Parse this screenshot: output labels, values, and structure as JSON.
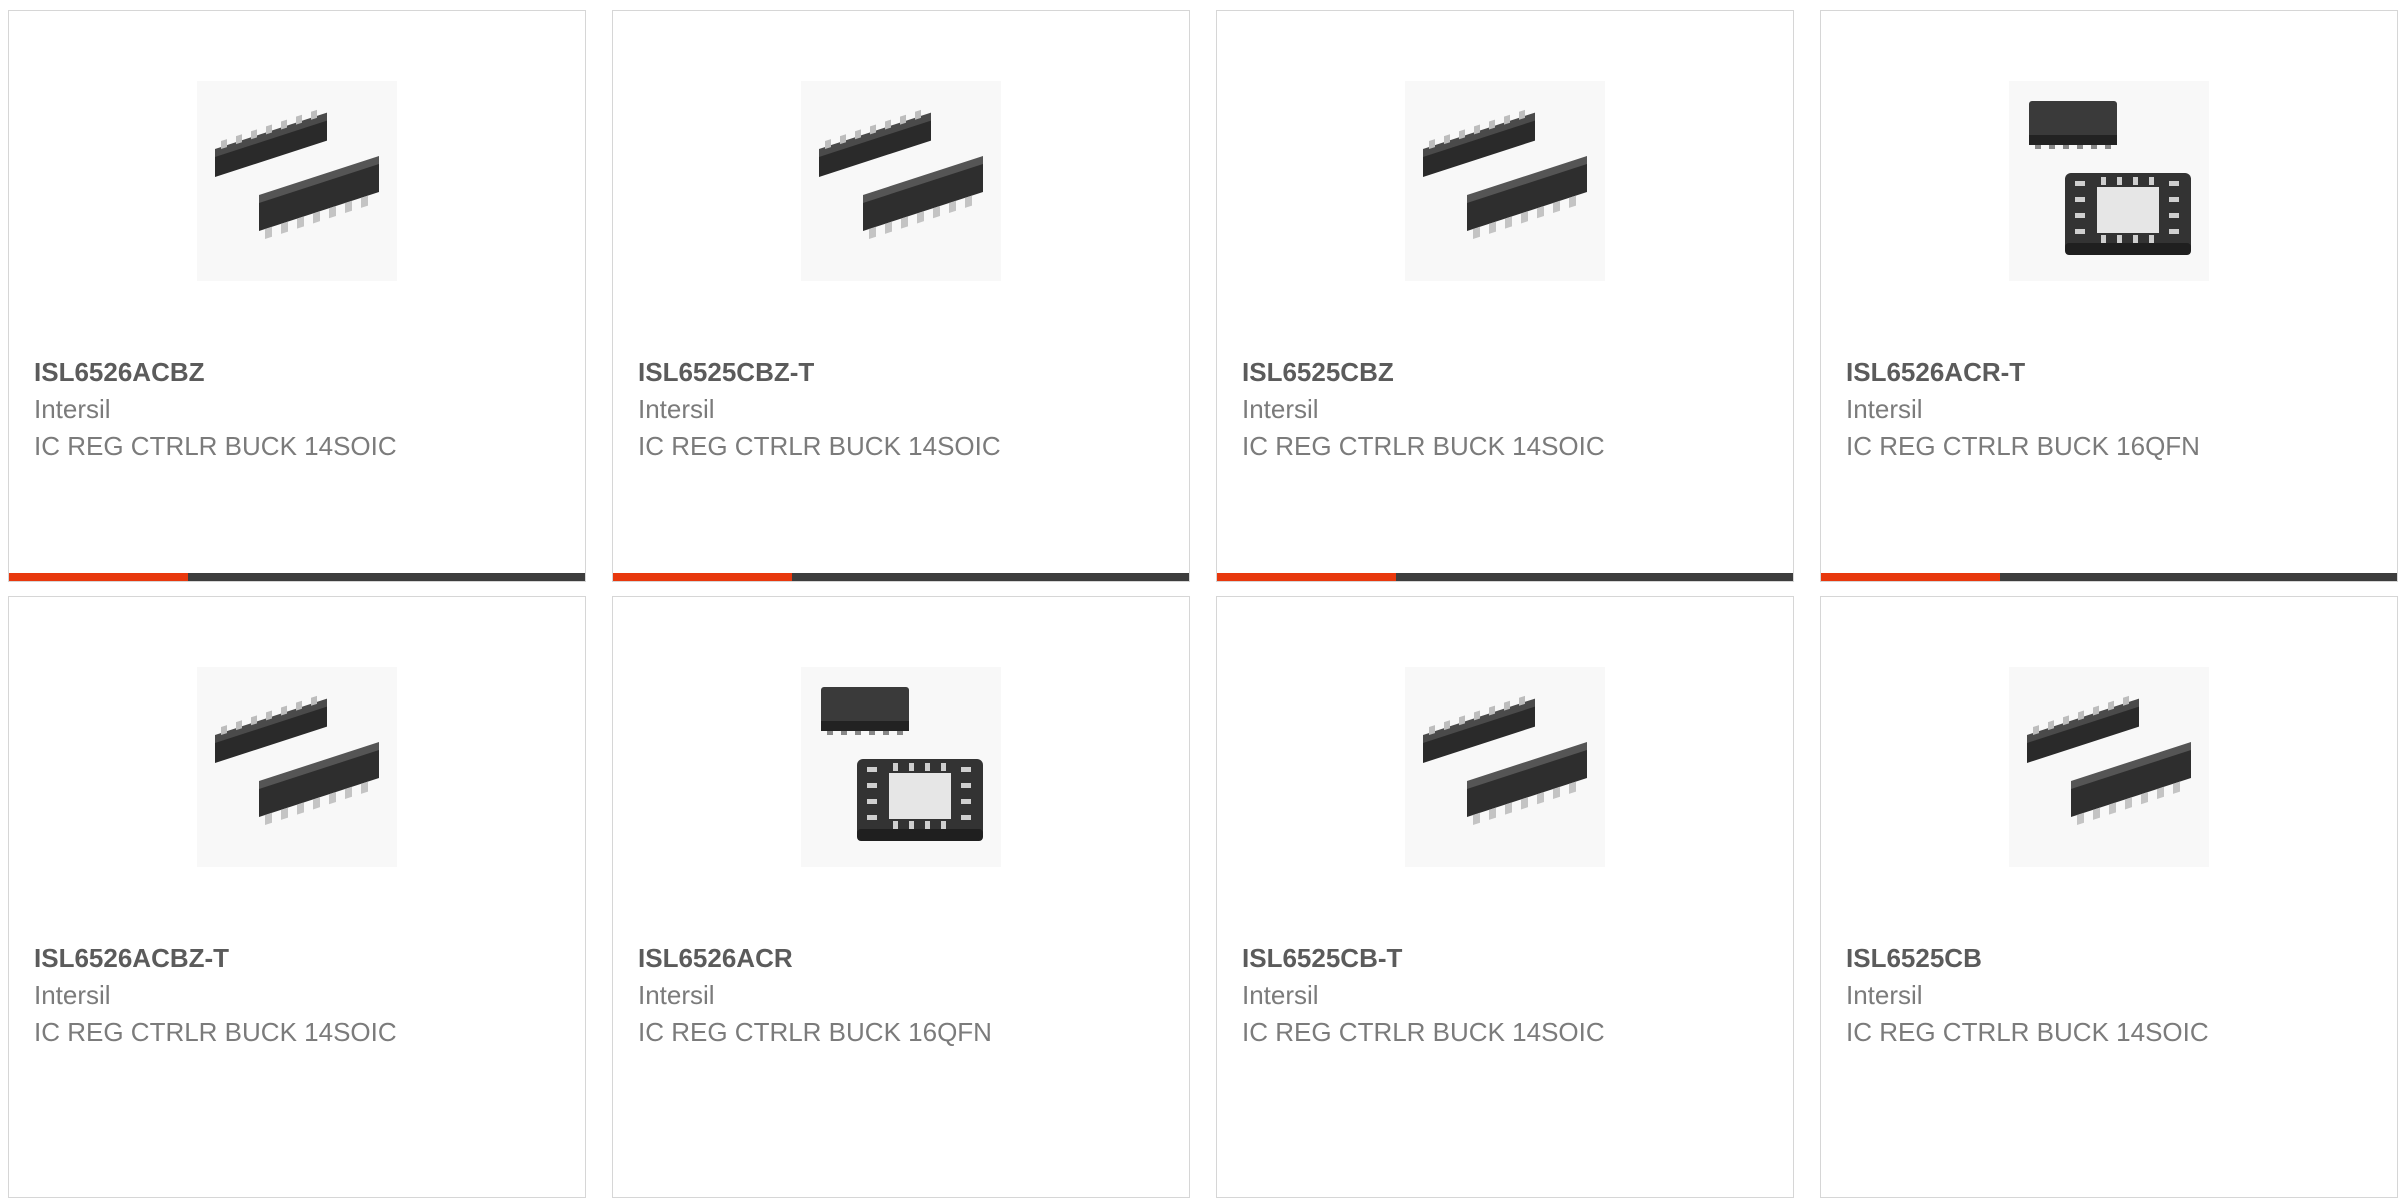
{
  "colors": {
    "accent": "#e8380d",
    "bar": "#3d3d3d",
    "part_text": "#5b5b5b",
    "secondary_text": "#7b7b7b",
    "border": "#d6d6d6"
  },
  "products": [
    {
      "part": "ISL6526ACBZ",
      "manufacturer": "Intersil",
      "description": "IC REG CTRLR BUCK 14SOIC",
      "image_icon": "soic-14-package-icon",
      "progress": 0.31
    },
    {
      "part": "ISL6525CBZ-T",
      "manufacturer": "Intersil",
      "description": "IC REG CTRLR BUCK 14SOIC",
      "image_icon": "soic-14-package-icon",
      "progress": 0.31
    },
    {
      "part": "ISL6525CBZ",
      "manufacturer": "Intersil",
      "description": "IC REG CTRLR BUCK 14SOIC",
      "image_icon": "soic-14-package-icon",
      "progress": 0.31
    },
    {
      "part": "ISL6526ACR-T",
      "manufacturer": "Intersil",
      "description": "IC REG CTRLR BUCK 16QFN",
      "image_icon": "qfn-16-package-icon",
      "progress": 0.31
    },
    {
      "part": "ISL6526ACBZ-T",
      "manufacturer": "Intersil",
      "description": "IC REG CTRLR BUCK 14SOIC",
      "image_icon": "soic-14-package-icon"
    },
    {
      "part": "ISL6526ACR",
      "manufacturer": "Intersil",
      "description": "IC REG CTRLR BUCK 16QFN",
      "image_icon": "qfn-16-package-icon"
    },
    {
      "part": "ISL6525CB-T",
      "manufacturer": "Intersil",
      "description": "IC REG CTRLR BUCK 14SOIC",
      "image_icon": "soic-14-package-icon"
    },
    {
      "part": "ISL6525CB",
      "manufacturer": "Intersil",
      "description": "IC REG CTRLR BUCK 14SOIC",
      "image_icon": "soic-14-package-icon"
    }
  ]
}
